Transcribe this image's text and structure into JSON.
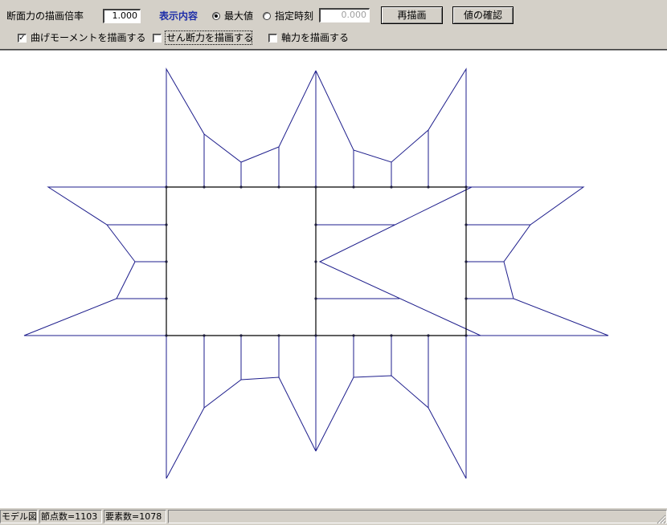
{
  "toolbar": {
    "scale_label": "断面力の描画倍率",
    "scale_value": "1.000",
    "display_label": "表示内容",
    "radio_max_label": "最大値",
    "radio_time_label": "指定時刻",
    "time_value": "0.000",
    "redraw_button": "再描画",
    "check_values_button": "値の確認",
    "bending_label": "曲げモーメントを描画する",
    "shear_label": "せん断力を描画する",
    "axial_label": "軸力を描画する"
  },
  "state": {
    "bending_checked": true,
    "shear_checked": false,
    "axial_checked": false,
    "radio_selected": "max"
  },
  "status": {
    "mode": "モデル図",
    "nodes": "節点数=1103",
    "elements": "要素数=1078"
  },
  "colors": {
    "diagram_line": "#1e1e8c",
    "frame_line": "#000000",
    "label_accent": "#1e2ea8"
  }
}
